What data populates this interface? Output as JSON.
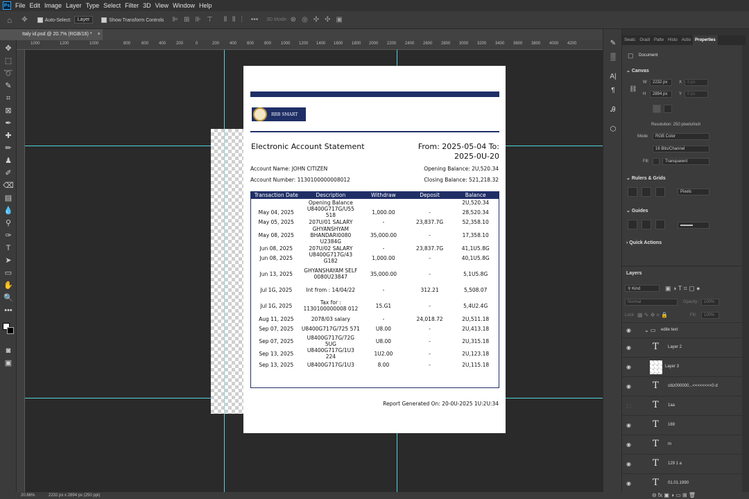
{
  "app": {
    "logo": "Ps"
  },
  "menu": [
    "File",
    "Edit",
    "Image",
    "Layer",
    "Type",
    "Select",
    "Filter",
    "3D",
    "View",
    "Window",
    "Help"
  ],
  "options": {
    "auto_select": "Auto-Select:",
    "layer_dropdown": "Layer",
    "show_transform": "Show Transform Controls",
    "mode_3d": "3D Mode:"
  },
  "document_tab": {
    "title": "Italy id.psd @ 20.7% (RGB/16) *",
    "close": "×"
  },
  "ruler": {
    "h_ticks": [
      "1000",
      "1200",
      "1000",
      "800",
      "600",
      "400",
      "200",
      "0",
      "200",
      "400",
      "600",
      "800",
      "1000",
      "1200",
      "1400",
      "1600",
      "1800",
      "2000",
      "2200",
      "2400",
      "2600",
      "2800",
      "3000",
      "3200",
      "3400",
      "3600",
      "3800",
      "4000",
      "4200"
    ]
  },
  "statement": {
    "bank_name": "RBB SMART",
    "title": "Electronic Account Statement",
    "period_line1": "From: 2025-05-04 To:",
    "period_line2": "2025-0U-20",
    "account_name": "Account Name: JOHN CITIZEN",
    "account_number": "Account  Number:  1130100000008012",
    "opening_balance": "Opening Balance: 2U,520.34",
    "closing_balance": "Closing Balance: 521,218.32",
    "columns": [
      "Transaction Date",
      "Description",
      "Withdraw",
      "Deposit",
      "Balance"
    ],
    "rows": [
      {
        "date": "",
        "desc": "Opening Balance",
        "withdraw": "",
        "deposit": "",
        "balance": "2U,520.34"
      },
      {
        "date": "May 04, 2025",
        "desc": "U8400G717G/U55 518",
        "withdraw": "1,000.00",
        "deposit": "-",
        "balance": "28,520.34"
      },
      {
        "date": "May 05, 2025",
        "desc": "207U/01 SALARY",
        "withdraw": "-",
        "deposit": "23,837.7G",
        "balance": "52,358.10"
      },
      {
        "date": "May 08, 2025",
        "desc": "GHYANSHYAM BHANDARI0080 U2384G",
        "withdraw": "35,000.00",
        "deposit": "-",
        "balance": "17,358.10"
      },
      {
        "date": "Jun 08, 2025",
        "desc": "207U/02 SALARY",
        "withdraw": "-",
        "deposit": "23,837.7G",
        "balance": "41,1U5.8G"
      },
      {
        "date": "Jun 08, 2025",
        "desc": "U8400G717G/43 G182",
        "withdraw": "1,000.00",
        "deposit": "-",
        "balance": "40,1U5.8G"
      },
      {
        "date": "Jun 13, 2025",
        "desc": "GHYANSHAYAM SELF 0080U23847",
        "withdraw": "35,000.00",
        "deposit": "-",
        "balance": "5,1U5.8G"
      },
      {
        "date": "Jul 1G, 2025",
        "desc": "Int from : 14/04/22",
        "withdraw": "-",
        "deposit": "312.21",
        "balance": "5,508.07"
      },
      {
        "date": "Jul 1G, 2025",
        "desc": "Tax for : 1130100000008 012",
        "withdraw": "15.G1",
        "deposit": "-",
        "balance": "5,4U2.4G"
      },
      {
        "date": "Aug 11, 2025",
        "desc": "2078/03 salary",
        "withdraw": "-",
        "deposit": "24,018.72",
        "balance": "2U,511.18"
      },
      {
        "date": "Sep 07, 2025",
        "desc": "U8400G717G/725 571",
        "withdraw": "U8.00",
        "deposit": "-",
        "balance": "2U,413.18"
      },
      {
        "date": "Sep 07, 2025",
        "desc": "U8400G717G/72G 5UG",
        "withdraw": "U8.00",
        "deposit": "-",
        "balance": "2U,315.18"
      },
      {
        "date": "Sep 13, 2025",
        "desc": "U8400G717G/1U3 224",
        "withdraw": "1U2.00",
        "deposit": "-",
        "balance": "2U,123.18"
      },
      {
        "date": "Sep 13, 2025",
        "desc": "U8400G717G/1U3",
        "withdraw": "8.00",
        "deposit": "-",
        "balance": "2U,115.18"
      }
    ],
    "generated": "Report  Generated  On:  20-0U-2025  1U:2U:34"
  },
  "panels": {
    "tabs": [
      "Swatc",
      "Gradi",
      "Patte",
      "Histo",
      "Actio",
      "Properties"
    ],
    "document_label": "Document",
    "canvas_section": "Canvas",
    "w_label": "W",
    "w_value": "2232 px",
    "h_label": "H",
    "h_value": "2894 px",
    "x_label": "X",
    "x_value": "0 px",
    "y_label": "Y",
    "y_value": "0 px",
    "resolution": "Resolution: 250 pixels/inch",
    "mode_label": "Mode",
    "mode_value": "RGB Color",
    "bits_value": "16 Bits/Channel",
    "fill_label": "Fill",
    "fill_value": "Transparent",
    "rulers_section": "Rulers & Grids",
    "units_value": "Pixels",
    "guides_section": "Guides",
    "quick_actions": "Quick Actions"
  },
  "layers": {
    "title": "Layers",
    "kind": "Kind",
    "blend": "Normal",
    "opacity_label": "Opacity:",
    "opacity_value": "100%",
    "lock_label": "Lock:",
    "fill_label": "Fill:",
    "fill_value": "100%",
    "group": "edite text",
    "items": [
      "Layer 2",
      "Layer 3",
      "citiz000000...<<<<<<<<0 d",
      "1aa",
      "169",
      "m",
      "129 1 a",
      "01.01.1990"
    ]
  },
  "status": {
    "zoom": "20.66%",
    "doc_info": "2232 px x 2894 px (250 ppi)"
  }
}
